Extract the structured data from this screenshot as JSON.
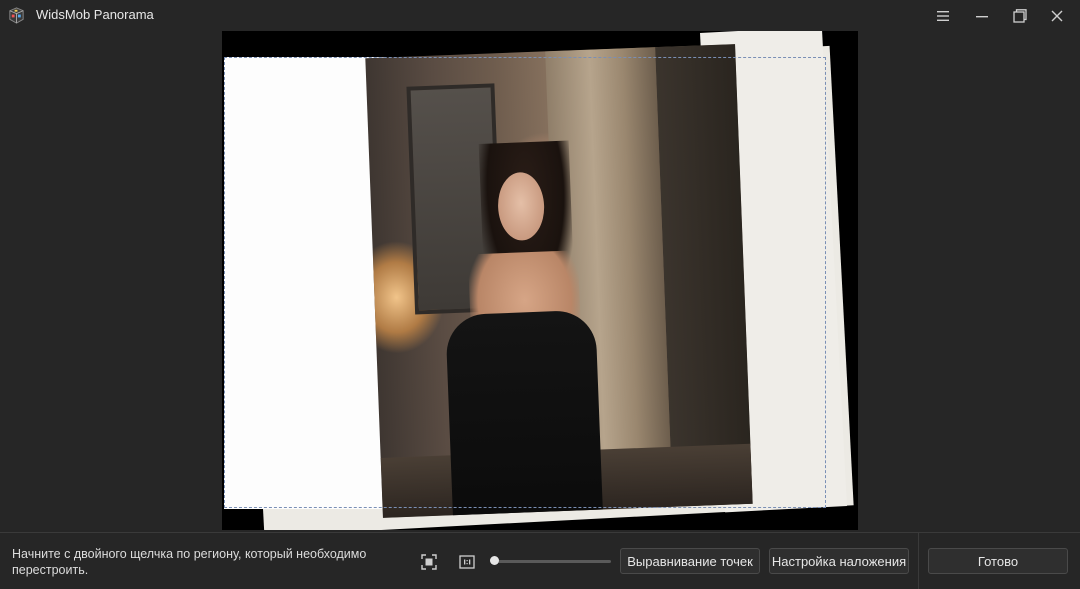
{
  "window": {
    "title": "WidsMob Panorama",
    "accent": "#7a8fb5"
  },
  "titlebar_icons": [
    "menu-icon",
    "minimize-icon",
    "maximize-icon",
    "close-icon"
  ],
  "bottombar": {
    "hint": "Начните с двойного щелчка по региону, который необходимо перестроить.",
    "zoom_slider_value": 0,
    "align_button": "Выравнивание точек",
    "overlay_button": "Настройка наложения",
    "done_button": "Готово"
  }
}
